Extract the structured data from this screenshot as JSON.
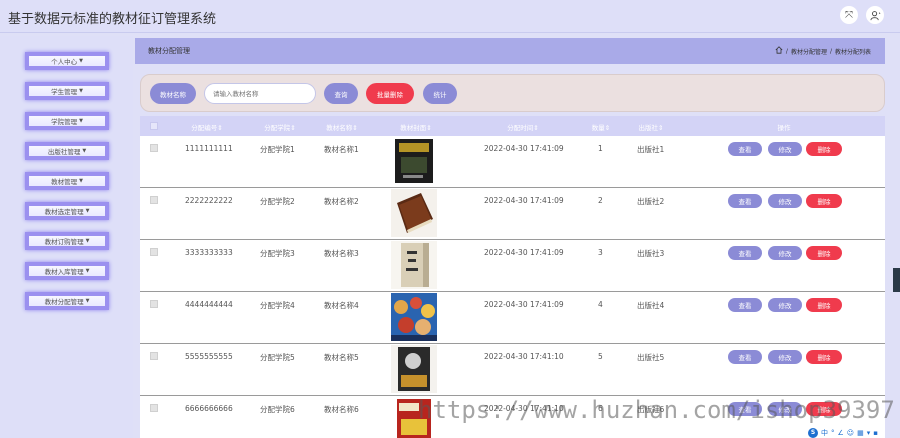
{
  "app": {
    "title": "基于数据元标准的教材征订管理系统"
  },
  "sidebar": {
    "items": [
      {
        "label": "个人中心"
      },
      {
        "label": "学生管理"
      },
      {
        "label": "学院管理"
      },
      {
        "label": "出版社管理"
      },
      {
        "label": "教材管理"
      },
      {
        "label": "教材选定管理"
      },
      {
        "label": "教材订购管理"
      },
      {
        "label": "教材入库管理"
      },
      {
        "label": "教材分配管理"
      }
    ]
  },
  "breadcrumb": {
    "title": "教材分配管理",
    "path_1": "教材分配管理",
    "path_2": "教材分配列表",
    "separator": "/"
  },
  "search": {
    "label": "教材名称",
    "placeholder": "请输入教材名称",
    "query_button": "查询",
    "batch_delete_button": "批量删除",
    "stats_button": "统计"
  },
  "table": {
    "headers": [
      "分配编号",
      "分配学院",
      "教材名称",
      "教材封面",
      "分配时间",
      "数量",
      "出版社",
      "操作"
    ],
    "header_suffix": "⇕",
    "rows": [
      {
        "id": "1111111111",
        "college": "分配学院1",
        "name": "教材名称1",
        "time": "2022-04-30 17:41:09",
        "qty": "1",
        "publisher": "出版社1"
      },
      {
        "id": "2222222222",
        "college": "分配学院2",
        "name": "教材名称2",
        "time": "2022-04-30 17:41:09",
        "qty": "2",
        "publisher": "出版社2"
      },
      {
        "id": "3333333333",
        "college": "分配学院3",
        "name": "教材名称3",
        "time": "2022-04-30 17:41:09",
        "qty": "3",
        "publisher": "出版社3"
      },
      {
        "id": "4444444444",
        "college": "分配学院4",
        "name": "教材名称4",
        "time": "2022-04-30 17:41:09",
        "qty": "4",
        "publisher": "出版社4"
      },
      {
        "id": "5555555555",
        "college": "分配学院5",
        "name": "教材名称5",
        "time": "2022-04-30 17:41:10",
        "qty": "5",
        "publisher": "出版社5"
      },
      {
        "id": "6666666666",
        "college": "分配学院6",
        "name": "教材名称6",
        "time": "2022-04-30 17:41:10",
        "qty": "6",
        "publisher": "出版社6"
      }
    ],
    "actions": {
      "view": "查看",
      "edit": "修改",
      "delete": "删除"
    }
  },
  "watermark": "https://www.huzhan.com/ishop39397",
  "colors": {
    "accent": "#8b8bd6",
    "danger": "#f03b4d",
    "sidebar_border": "#9b90ef",
    "header_bg": "#a9aae8"
  },
  "icons": {
    "fullscreen": "fullscreen-icon",
    "user": "user-icon",
    "home": "home-icon"
  }
}
